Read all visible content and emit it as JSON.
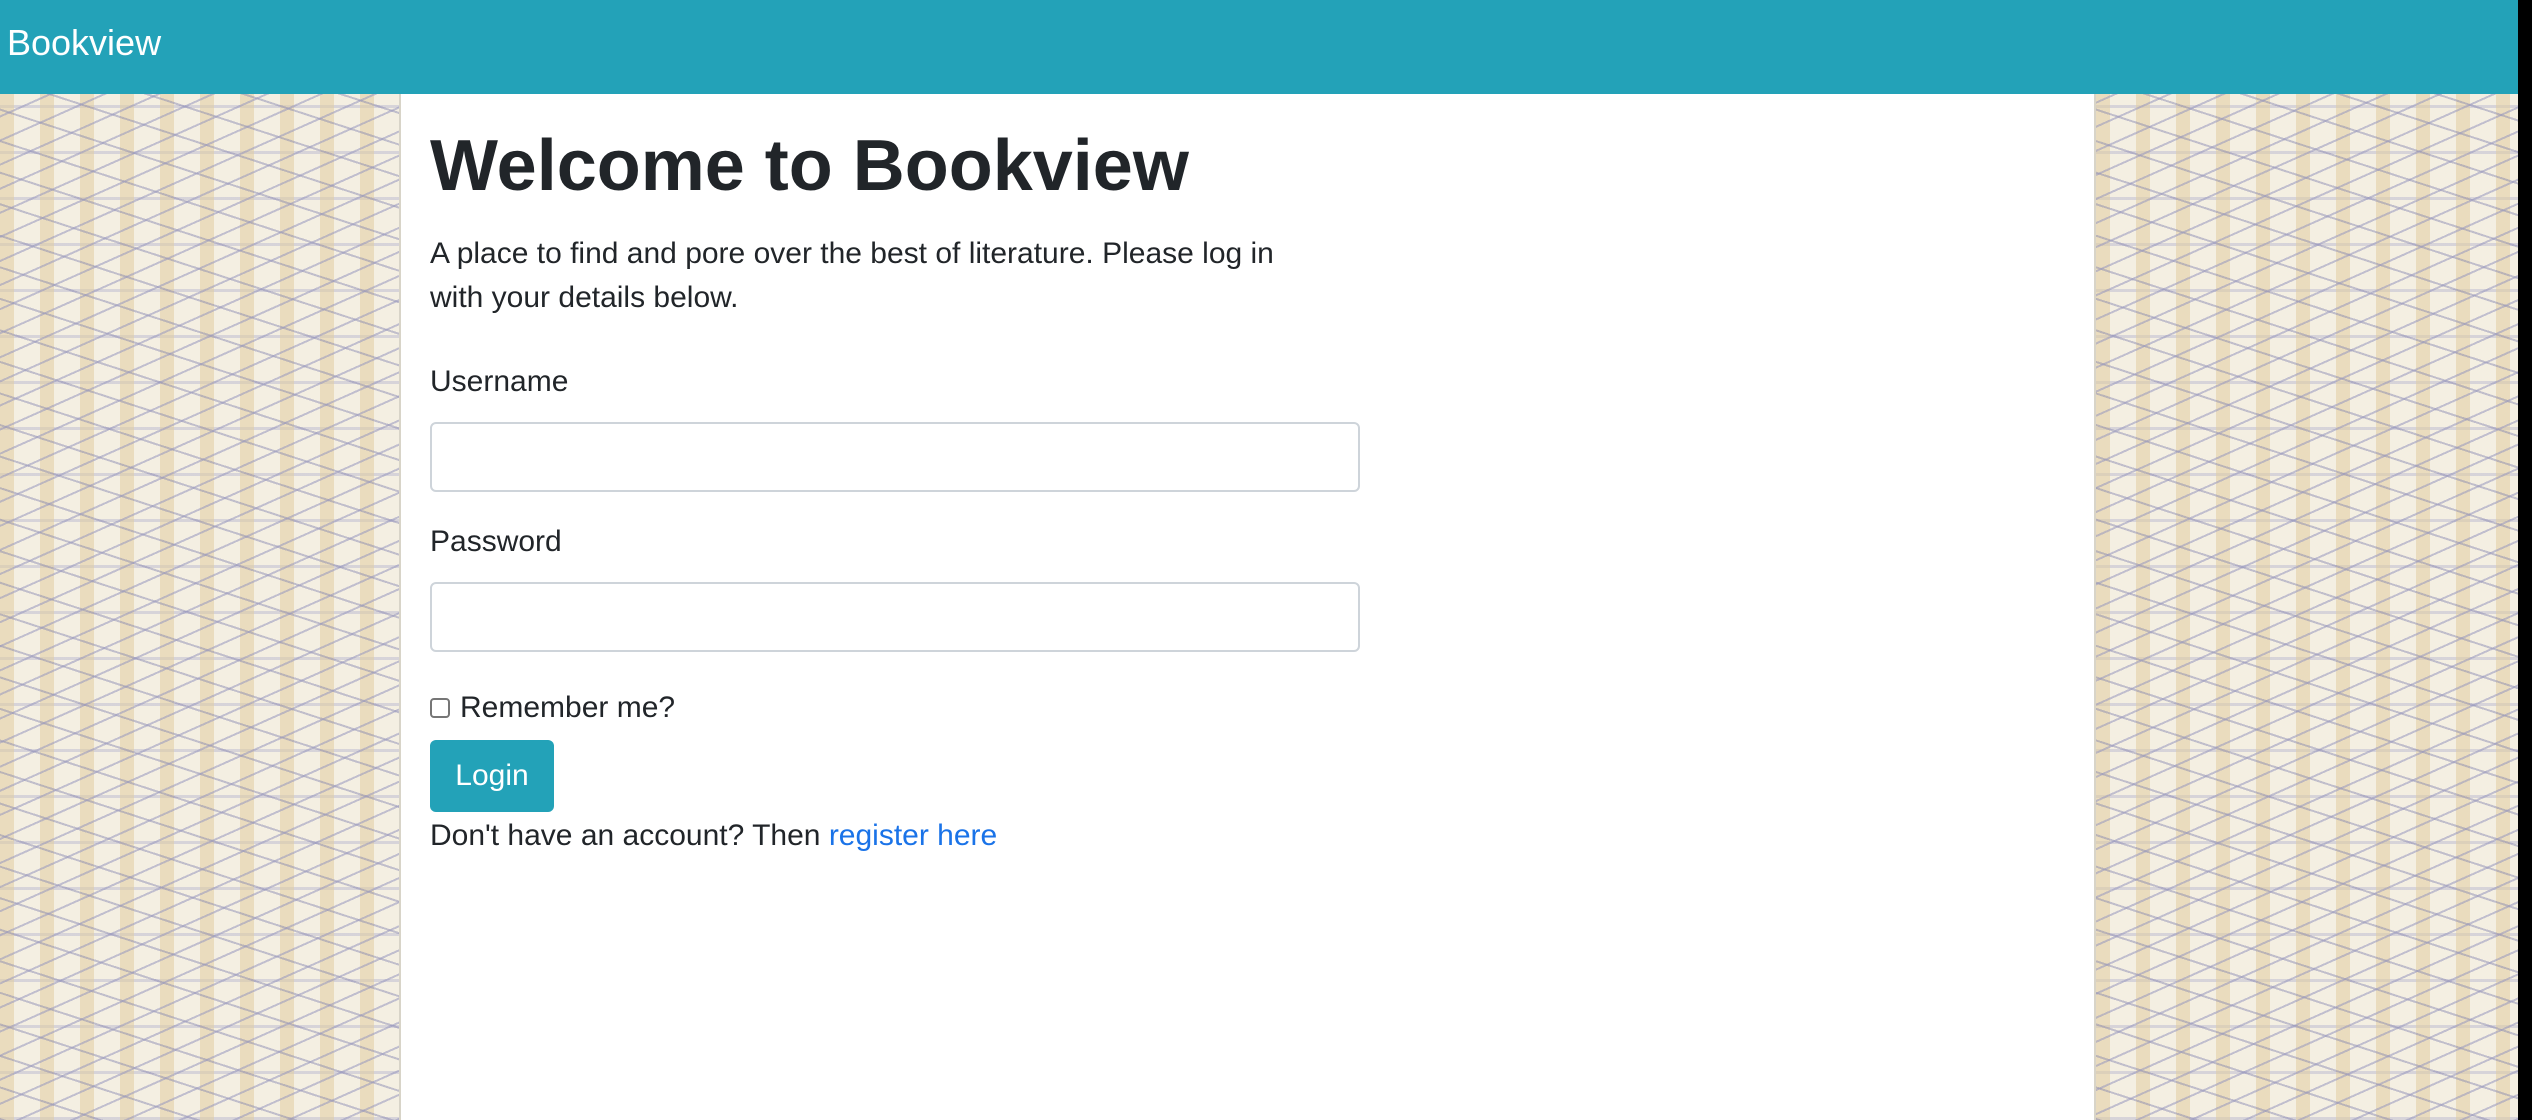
{
  "navbar": {
    "brand": "Bookview"
  },
  "main": {
    "title": "Welcome to Bookview",
    "description": "A place to find and pore over the best of literature. Please log in with your details below."
  },
  "form": {
    "username_label": "Username",
    "username_value": "",
    "password_label": "Password",
    "password_value": "",
    "remember_label": "Remember me?",
    "remember_checked": false,
    "login_label": "Login"
  },
  "footer": {
    "register_prefix": "Don't have an account? Then",
    "register_link": "register here"
  },
  "colors": {
    "brand": "#23a2b8",
    "link": "#1a73e8",
    "text": "#212529"
  }
}
